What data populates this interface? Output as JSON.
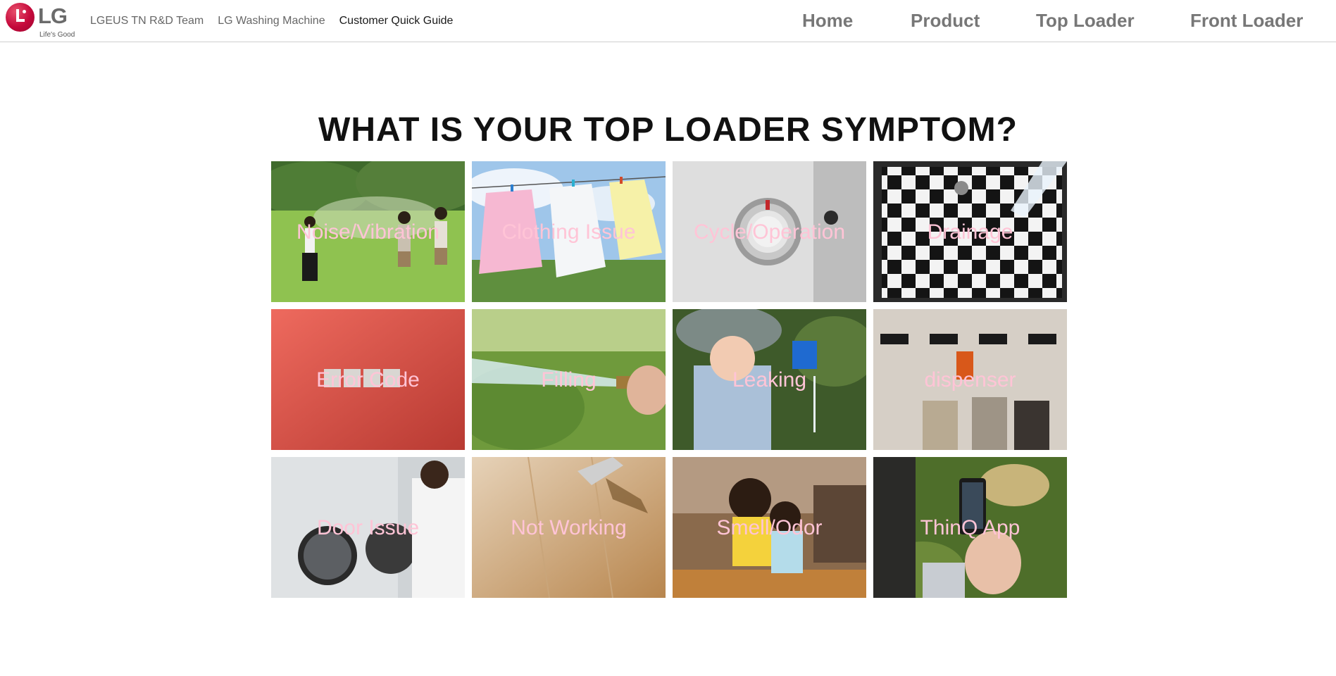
{
  "header": {
    "logo": {
      "word": "LG",
      "tagline": "Life's Good"
    },
    "breadcrumbs": [
      {
        "label": "LGEUS TN R&D Team"
      },
      {
        "label": "LG Washing Machine"
      },
      {
        "label": "Customer Quick Guide"
      }
    ],
    "nav": [
      {
        "label": "Home"
      },
      {
        "label": "Product"
      },
      {
        "label": "Top Loader"
      },
      {
        "label": "Front Loader"
      }
    ]
  },
  "main": {
    "title": "WHAT IS YOUR TOP LOADER SYMPTOM?",
    "label_color": "#ffc4d6",
    "tiles": [
      {
        "label": "Noise/Vibration",
        "icon": "people-covering-ears-photo"
      },
      {
        "label": "Clothing Issue",
        "icon": "clothes-on-line-photo"
      },
      {
        "label": "Cycle/Operation",
        "icon": "cycle-dial-photo"
      },
      {
        "label": "Drainage",
        "icon": "sink-drain-photo"
      },
      {
        "label": "Error Code",
        "icon": "error-code-blocks-photo"
      },
      {
        "label": "Filling",
        "icon": "water-hose-photo"
      },
      {
        "label": "Leaking",
        "icon": "child-water-cup-photo"
      },
      {
        "label": "dispenser",
        "icon": "dispenser-jars-photo"
      },
      {
        "label": "Door Issue",
        "icon": "washer-door-photo"
      },
      {
        "label": "Not Working",
        "icon": "unplugged-cord-photo"
      },
      {
        "label": "Smell/Odor",
        "icon": "mother-daughter-photo"
      },
      {
        "label": "ThinQ App",
        "icon": "smartphone-app-photo"
      }
    ]
  }
}
